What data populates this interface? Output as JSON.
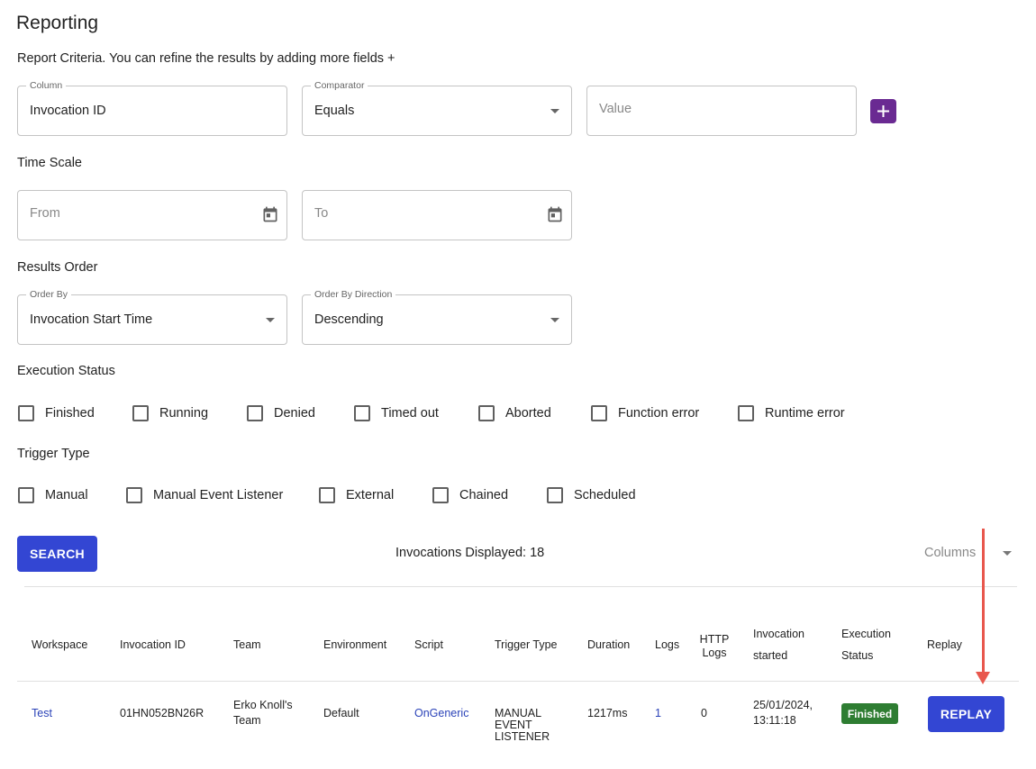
{
  "page": {
    "title": "Reporting",
    "criteria_text": "Report Criteria. You can refine the results by adding more fields +"
  },
  "criteria": {
    "column": {
      "label": "Column",
      "value": "Invocation ID"
    },
    "comparator": {
      "label": "Comparator",
      "value": "Equals"
    },
    "value": {
      "placeholder": "Value"
    },
    "add_icon": "plus-icon"
  },
  "time_scale": {
    "heading": "Time Scale",
    "from": {
      "placeholder": "From"
    },
    "to": {
      "placeholder": "To"
    },
    "icon": "calendar-icon"
  },
  "results_order": {
    "heading": "Results Order",
    "order_by": {
      "label": "Order By",
      "value": "Invocation Start Time"
    },
    "direction": {
      "label": "Order By Direction",
      "value": "Descending"
    }
  },
  "execution_status": {
    "heading": "Execution Status",
    "options": [
      "Finished",
      "Running",
      "Denied",
      "Timed out",
      "Aborted",
      "Function error",
      "Runtime error"
    ]
  },
  "trigger_type": {
    "heading": "Trigger Type",
    "options": [
      "Manual",
      "Manual Event Listener",
      "External",
      "Chained",
      "Scheduled"
    ]
  },
  "actions": {
    "search_label": "SEARCH",
    "invocations_text": "Invocations Displayed: 18",
    "columns_label": "Columns"
  },
  "table": {
    "headers": {
      "workspace": "Workspace",
      "invocation_id": "Invocation ID",
      "team": "Team",
      "environment": "Environment",
      "script": "Script",
      "trigger_type": "Trigger Type",
      "duration": "Duration",
      "logs": "Logs",
      "http_logs_1": "HTTP",
      "http_logs_2": "Logs",
      "invocation_started_1": "Invocation",
      "invocation_started_2": "started",
      "execution_status_1": "Execution",
      "execution_status_2": "Status",
      "replay": "Replay"
    },
    "row": {
      "workspace": "Test",
      "invocation_id": "01HN052BN26R",
      "team_1": "Erko Knoll's",
      "team_2": "Team",
      "environment": "Default",
      "script": "OnGeneric",
      "trigger_1": "MANUAL",
      "trigger_2": "EVENT",
      "trigger_3": "LISTENER",
      "duration": "1217ms",
      "logs": "1",
      "http_logs": "0",
      "started_1": "25/01/2024,",
      "started_2": "13:11:18",
      "status": "Finished",
      "replay_label": "REPLAY"
    }
  },
  "colors": {
    "primary": "#3346d3",
    "add_button": "#6a2a92",
    "status_finished": "#2e7d32",
    "annotation_arrow": "#e8574d",
    "link": "#2b43b8"
  }
}
